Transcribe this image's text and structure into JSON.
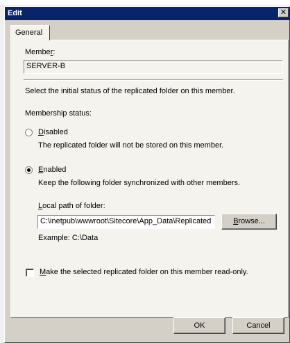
{
  "window": {
    "title": "Edit",
    "close_glyph": "✕"
  },
  "tabs": [
    {
      "label": "General"
    }
  ],
  "member": {
    "label_pre": "Membe",
    "label_accel": "r",
    "label_post": ":",
    "value": "SERVER-B"
  },
  "instruction": "Select the initial status of the replicated folder on this member.",
  "membership": {
    "label": "Membership status:",
    "disabled": {
      "accel": "D",
      "label_rest": "isabled",
      "description": "The replicated folder will not be stored on this member.",
      "selected": false
    },
    "enabled": {
      "accel": "E",
      "label_rest": "nabled",
      "description": "Keep the following folder synchronized with other members.",
      "selected": true
    }
  },
  "local_path": {
    "label_accel": "L",
    "label_rest": "ocal path of folder:",
    "value": "C:\\inetpub\\wwwroot\\Sitecore\\App_Data\\Replicated",
    "example": "Example: C:\\Data"
  },
  "browse_button": {
    "accel": "B",
    "rest": "rowse..."
  },
  "readonly_checkbox": {
    "accel": "M",
    "rest": "ake the selected replicated folder on this member read-only.",
    "checked": false
  },
  "footer": {
    "ok": "OK",
    "cancel": "Cancel"
  }
}
